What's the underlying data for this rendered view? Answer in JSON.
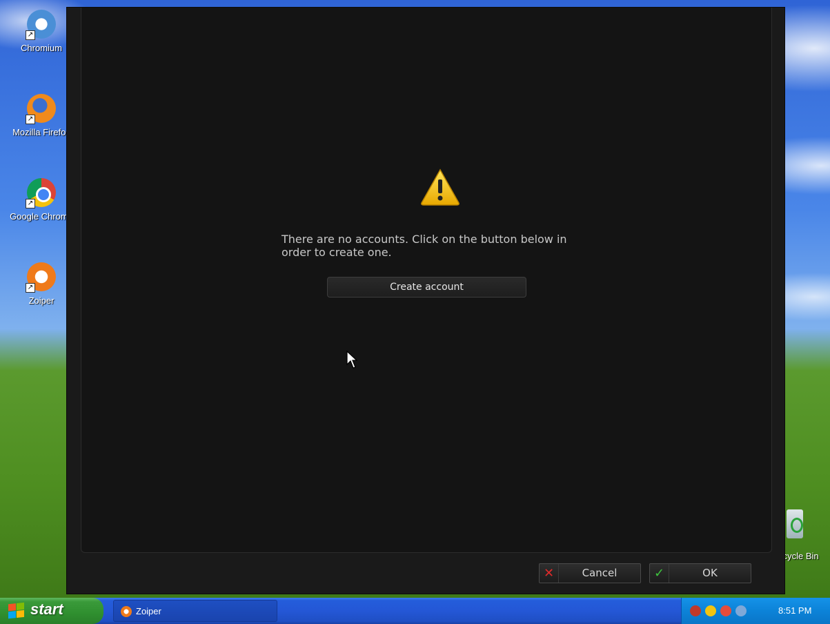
{
  "desktop": {
    "icons": [
      {
        "label": "Chromium",
        "icon": "chromium-icon"
      },
      {
        "label": "Mozilla Firefox",
        "icon": "firefox-icon"
      },
      {
        "label": "Google Chrome",
        "icon": "chrome-icon"
      },
      {
        "label": "Zoiper",
        "icon": "zoiper-icon"
      }
    ],
    "recycle_bin": {
      "label": "Recycle Bin",
      "icon": "recycle-bin-icon"
    }
  },
  "dialog": {
    "warning_icon": "warning-triangle-icon",
    "message": "There are no accounts. Click on the button below in order to create one.",
    "create_button_label": "Create account",
    "cancel_label": "Cancel",
    "ok_label": "OK"
  },
  "taskbar": {
    "start_label": "start",
    "task_label": "Zoiper",
    "clock": "8:51 PM"
  },
  "colors": {
    "dialog_bg": "#141414",
    "cancel_icon": "#e02a2a",
    "ok_icon": "#3ec43e",
    "warning": "#f5c400"
  }
}
